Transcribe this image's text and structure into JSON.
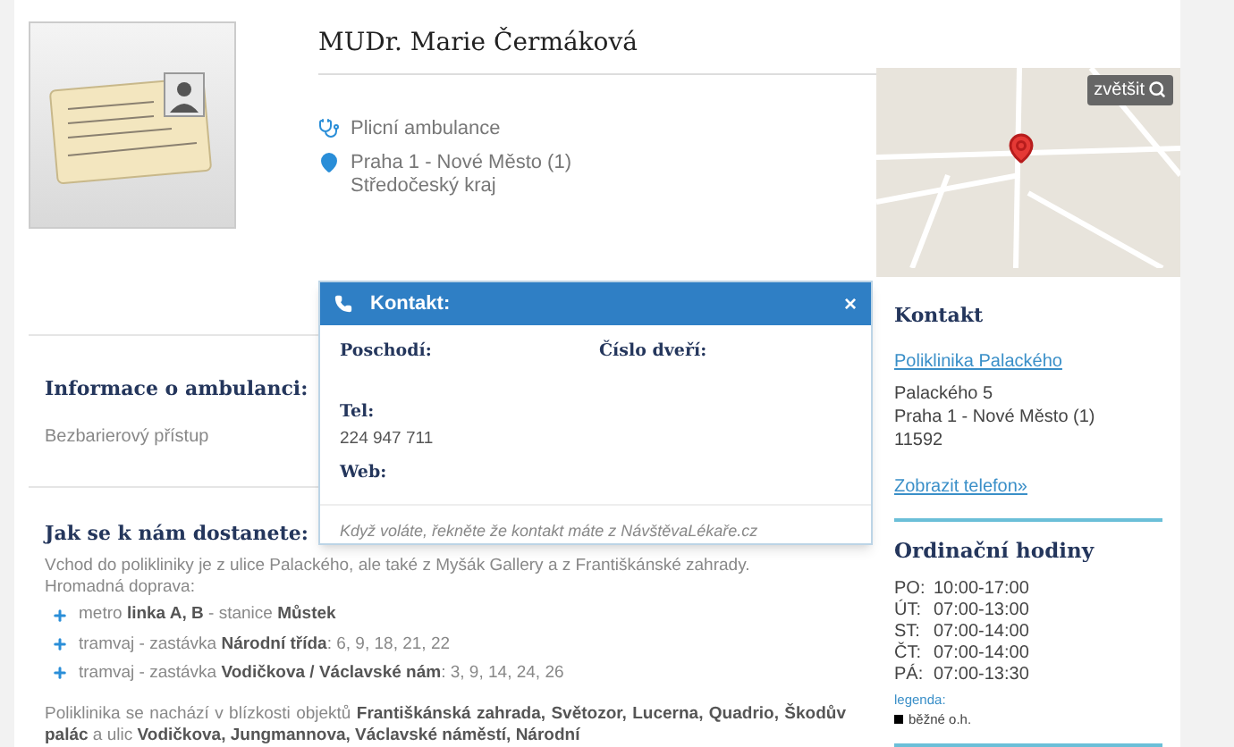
{
  "profile": {
    "name": "MUDr. Marie Čermáková",
    "specialty": "Plicní ambulance",
    "address_lines": [
      "Praha 1 - Nové Město (1)",
      "Středočeský kraj"
    ]
  },
  "info": {
    "title": "Informace o ambulanci:",
    "text": "Bezbarierový přístup"
  },
  "directions": {
    "title": "Jak se k nám dostanete:",
    "intro": [
      "Vchod do polikliniky je z ulice Palackého, ale také z Myšák Gallery a z Františkánské zahrady.",
      "Hromadná doprava:"
    ],
    "transport": [
      "metro **linka A, B** - stanice **Můstek**",
      "tramvaj - zastávka **Národní třída**: 6, 9, 18, 21, 22",
      "tramvaj - zastávka **Vodičkova / Václavské nám**: 3, 9, 14, 24, 26"
    ],
    "nearby": "Poliklinika se nachází v blízkosti objektů **Františkánská zahrada, Světozor, Lucerna, Quadrio, Škodův palác** a ulic **Vodičkova, Jungmannova, Václavské náměstí, Národní**"
  },
  "map": {
    "zoom_button": "zvětšit"
  },
  "contact": {
    "title": "Kontakt",
    "clinic_link": "Poliklinika Palackého",
    "address_lines": [
      "Palackého 5",
      "Praha 1 - Nové Město (1)",
      "11592"
    ],
    "phone_link": "Zobrazit telefon»"
  },
  "hours": {
    "title": "Ordinační hodiny",
    "days": [
      {
        "day": "PO:",
        "time": "10:00-17:00"
      },
      {
        "day": "ÚT:",
        "time": "07:00-13:00"
      },
      {
        "day": "ST:",
        "time": "07:00-14:00"
      },
      {
        "day": "ČT:",
        "time": "07:00-14:00"
      },
      {
        "day": "PÁ:",
        "time": "07:00-13:30"
      }
    ],
    "legend_label": "legenda:",
    "legend_item": "běžné o.h."
  },
  "modal": {
    "title": "Kontakt:",
    "close": "×",
    "floor_label": "Poschodí:",
    "door_label": "Číslo dveří:",
    "tel_label": "Tel:",
    "tel": "224 947 711",
    "web_label": "Web:",
    "note": "Když voláte, řekněte že kontakt máte z NávštěvaLékaře.cz"
  }
}
